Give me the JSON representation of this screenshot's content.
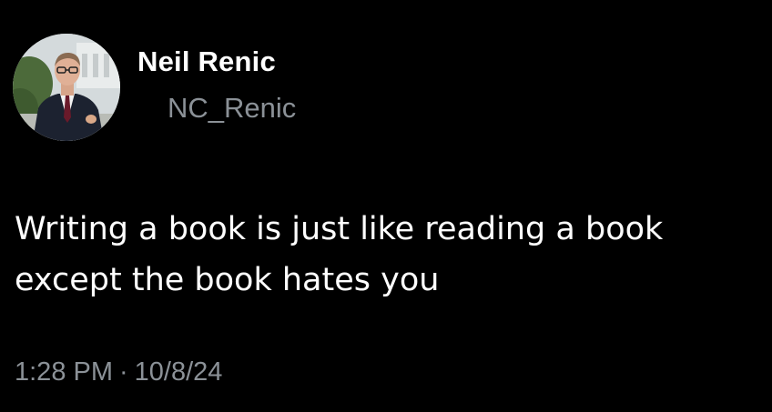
{
  "author": {
    "display_name": "Neil Renic",
    "handle": "NC_Renic",
    "avatar_icon": "profile-photo"
  },
  "tweet": {
    "lines": [
      "Writing a book is just like reading a book",
      "except the book hates you"
    ]
  },
  "meta": {
    "time": "1:28 PM",
    "separator": "·",
    "date": "10/8/24"
  },
  "colors": {
    "background": "#000000",
    "primary_text": "#ffffff",
    "secondary_text": "#8b9197"
  }
}
